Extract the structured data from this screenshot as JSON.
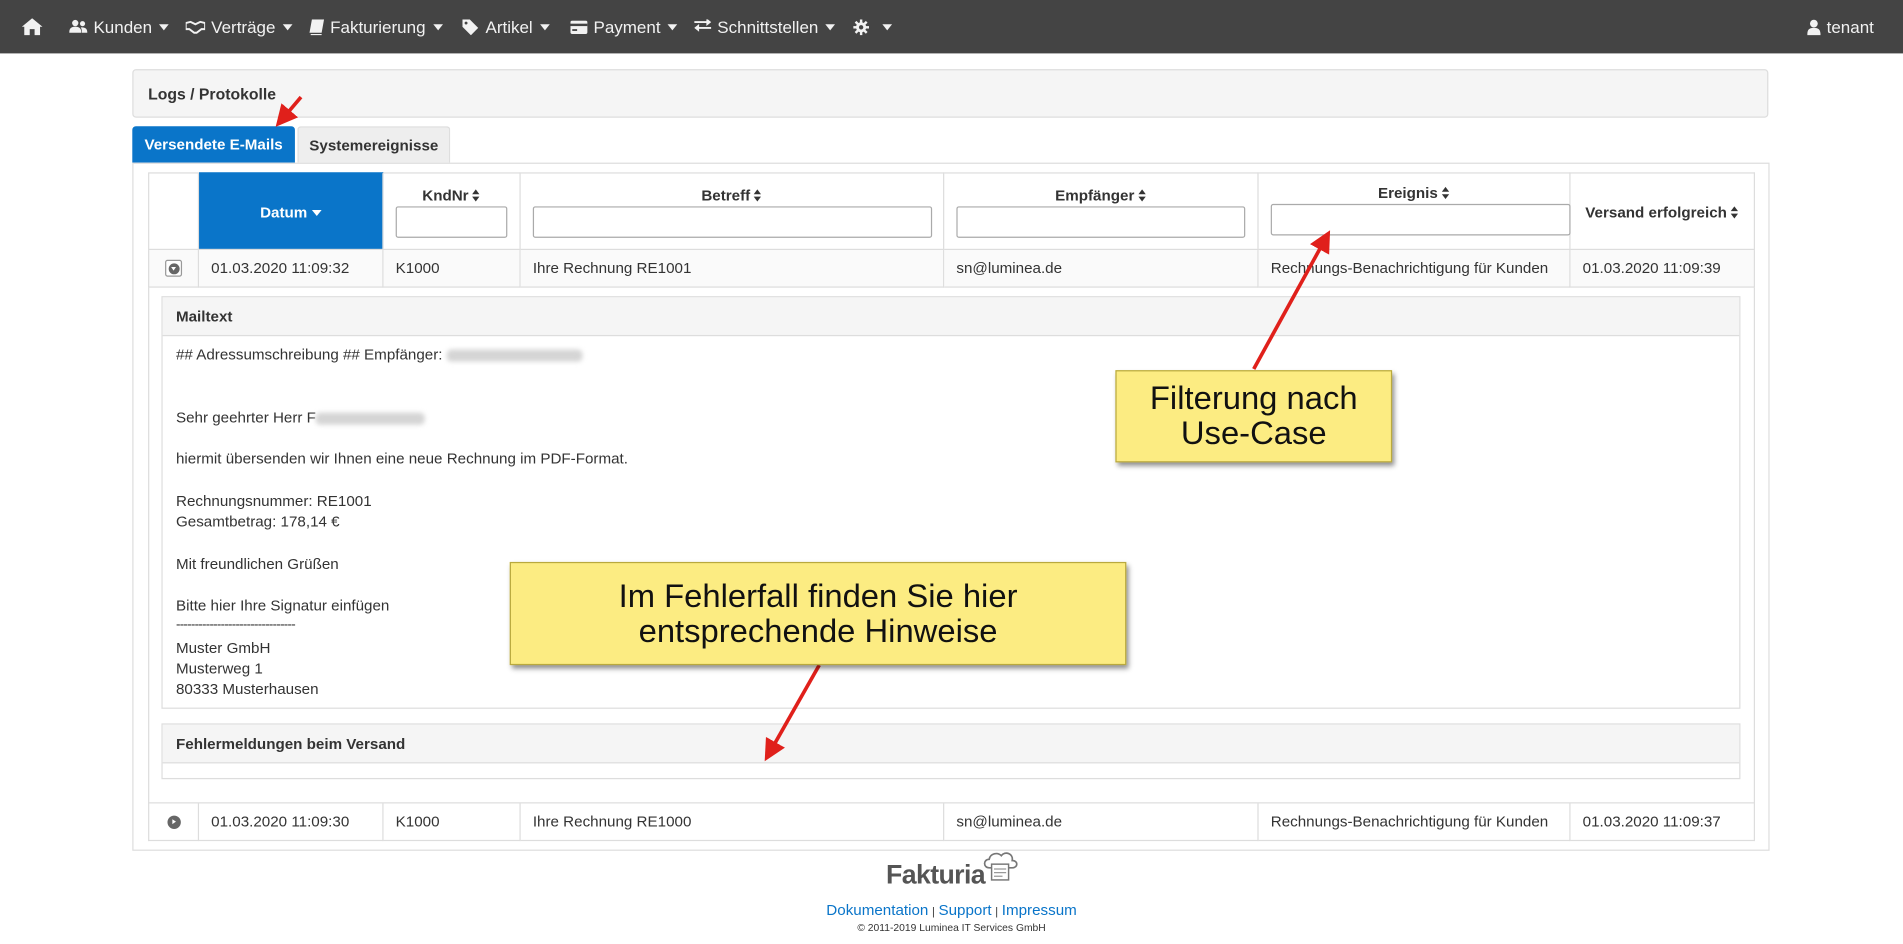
{
  "nav": {
    "kunden": "Kunden",
    "vertraege": "Verträge",
    "fakturierung": "Fakturierung",
    "artikel": "Artikel",
    "payment": "Payment",
    "schnittstellen": "Schnittstellen",
    "user": "tenant"
  },
  "page": {
    "title": "Logs / Protokolle"
  },
  "tabs": {
    "emails": "Versendete E-Mails",
    "events": "Systemereignisse"
  },
  "table": {
    "columns": {
      "datum": "Datum",
      "kndnr": "KndNr",
      "betreff": "Betreff",
      "empfaenger": "Empfänger",
      "ereignis": "Ereignis",
      "versand": "Versand erfolgreich"
    },
    "rows": [
      {
        "datum": "01.03.2020 11:09:32",
        "kndnr": "K1000",
        "betreff": "Ihre Rechnung RE1001",
        "empfaenger": "sn@luminea.de",
        "ereignis": "Rechnungs-Benachrichtigung für Kunden",
        "versand": "01.03.2020 11:09:39"
      },
      {
        "datum": "01.03.2020 11:09:30",
        "kndnr": "K1000",
        "betreff": "Ihre Rechnung RE1000",
        "empfaenger": "sn@luminea.de",
        "ereignis": "Rechnungs-Benachrichtigung für Kunden",
        "versand": "01.03.2020 11:09:37"
      }
    ]
  },
  "detail": {
    "mailtext_title": "Mailtext",
    "lines": {
      "addr": "## Adressumschreibung ## Empfänger:",
      "greeting": "Sehr geehrter Herr F",
      "intro": "hiermit übersenden wir Ihnen eine neue Rechnung im PDF-Format.",
      "invoice_no": "Rechnungsnummer: RE1001",
      "total": "Gesamtbetrag: 178,14 €",
      "regards": "Mit freundlichen Grüßen",
      "signature": "Bitte hier Ihre Signatur einfügen",
      "dashes": "--------------------------------",
      "company": "Muster GmbH",
      "street": "Musterweg 1",
      "city": "80333 Musterhausen"
    },
    "errors_title": "Fehlermeldungen beim Versand"
  },
  "callouts": {
    "filter": "Filterung nach\nUse-Case",
    "error": "Im Fehlerfall finden Sie hier\nentsprechende Hinweise"
  },
  "footer": {
    "brand": "Fakturia",
    "links": {
      "doku": "Dokumentation",
      "support": "Support",
      "impressum": "Impressum"
    },
    "copyright": "© 2011-2019 Luminea IT Services GmbH"
  },
  "colors": {
    "accent": "#0a75c9",
    "navbar": "#444444",
    "callout": "#fcec82",
    "arrow": "#e0201b"
  },
  "icons": [
    "home-icon",
    "users-icon",
    "handshake-icon",
    "book-icon",
    "tags-icon",
    "credit-card-icon",
    "exchange-icon",
    "gear-icon",
    "user-icon",
    "chevron-down-circle-icon",
    "chevron-right-circle-icon",
    "sort-icon",
    "sort-desc-icon"
  ]
}
